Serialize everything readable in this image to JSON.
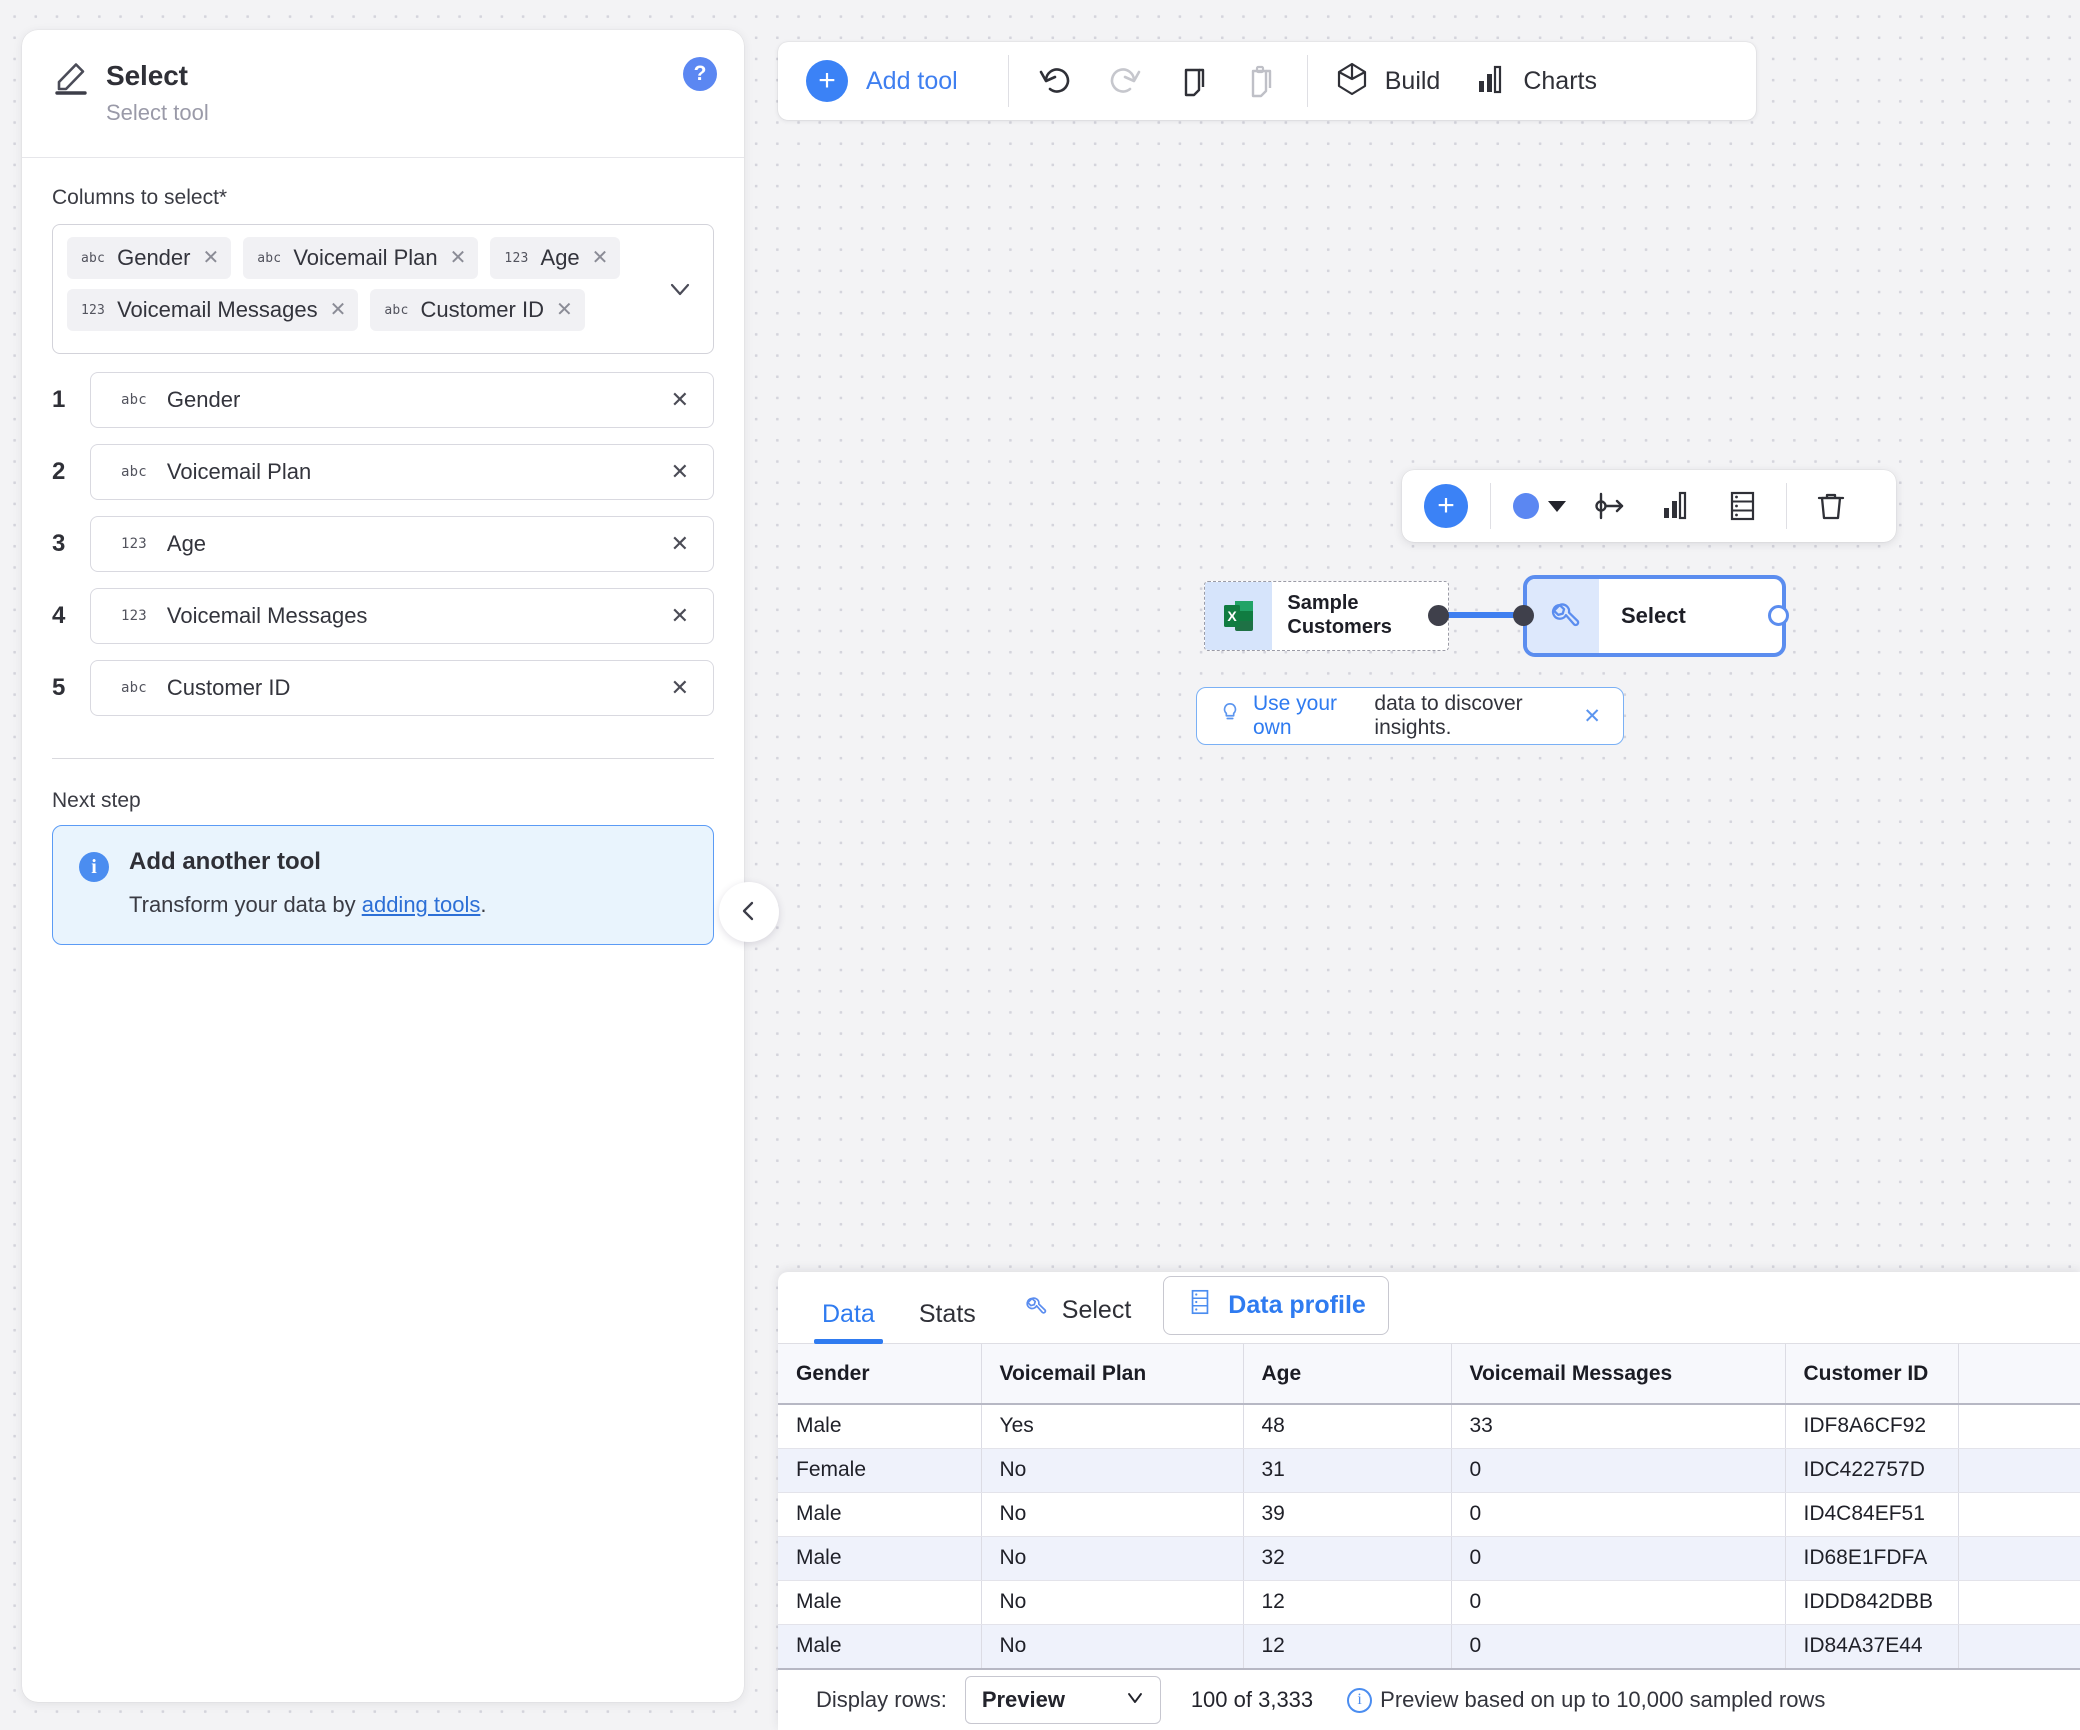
{
  "left_panel": {
    "title": "Select",
    "subtitle": "Select tool",
    "help_label": "?",
    "columns_field_label": "Columns to select*",
    "chips": [
      {
        "type_badge": "abc",
        "label": "Gender",
        "remove": "✕"
      },
      {
        "type_badge": "abc",
        "label": "Voicemail Plan",
        "remove": "✕"
      },
      {
        "type_badge": "123",
        "label": "Age",
        "remove": "✕"
      },
      {
        "type_badge": "123",
        "label": "Voicemail Messages",
        "remove": "✕"
      },
      {
        "type_badge": "abc",
        "label": "Customer ID",
        "remove": "✕"
      }
    ],
    "column_rows": [
      {
        "num": "1",
        "type_badge": "abc",
        "name": "Gender",
        "remove": "✕"
      },
      {
        "num": "2",
        "type_badge": "abc",
        "name": "Voicemail Plan",
        "remove": "✕"
      },
      {
        "num": "3",
        "type_badge": "123",
        "name": "Age",
        "remove": "✕"
      },
      {
        "num": "4",
        "type_badge": "123",
        "name": "Voicemail Messages",
        "remove": "✕"
      },
      {
        "num": "5",
        "type_badge": "abc",
        "name": "Customer ID",
        "remove": "✕"
      }
    ],
    "next_step_label": "Next step",
    "info_card": {
      "badge": "i",
      "title": "Add another tool",
      "text_before": "Transform your data by ",
      "link": "adding tools",
      "text_after": "."
    }
  },
  "toolbar": {
    "add_tool_label": "Add tool",
    "plus": "+",
    "undo_icon": "undo-icon",
    "redo_icon": "redo-icon",
    "copy_icon": "copy-icon",
    "paste_icon": "paste-icon",
    "build_label": "Build",
    "charts_label": "Charts"
  },
  "node_toolbar": {
    "plus": "+",
    "color_swatch_hex": "#5b87f2",
    "branch_icon": "branch-icon",
    "chart_icon": "bar-chart-icon",
    "profile_icon": "data-profile-icon",
    "delete_icon": "trash-icon"
  },
  "canvas": {
    "source_node": {
      "label": "Sample Customers",
      "icon": "excel-icon"
    },
    "select_node": {
      "label": "Select",
      "icon": "wrench-icon"
    },
    "tip": {
      "link": "Use your own",
      "text": " data to discover insights.",
      "close": "✕"
    }
  },
  "data_panel": {
    "tabs": [
      {
        "label": "Data",
        "active": true
      },
      {
        "label": "Stats",
        "active": false
      }
    ],
    "tool_tab": {
      "label": "Select",
      "icon": "wrench-icon"
    },
    "profile_button": {
      "label": "Data profile",
      "icon": "data-profile-icon"
    },
    "table": {
      "columns": [
        "Gender",
        "Voicemail Plan",
        "Age",
        "Voicemail Messages",
        "Customer ID",
        ""
      ],
      "rows": [
        [
          "Male",
          "Yes",
          "48",
          "33",
          "IDF8A6CF92",
          ""
        ],
        [
          "Female",
          "No",
          "31",
          "0",
          "IDC422757D",
          ""
        ],
        [
          "Male",
          "No",
          "39",
          "0",
          "ID4C84EF51",
          ""
        ],
        [
          "Male",
          "No",
          "32",
          "0",
          "ID68E1FDFA",
          ""
        ],
        [
          "Male",
          "No",
          "12",
          "0",
          "IDDD842DBB",
          ""
        ],
        [
          "Male",
          "No",
          "12",
          "0",
          "ID84A37E44",
          ""
        ]
      ]
    },
    "status": {
      "display_rows_label": "Display rows:",
      "select_value": "Preview",
      "count": "100 of 3,333",
      "note": "Preview based on up to 10,000 sampled rows"
    }
  }
}
